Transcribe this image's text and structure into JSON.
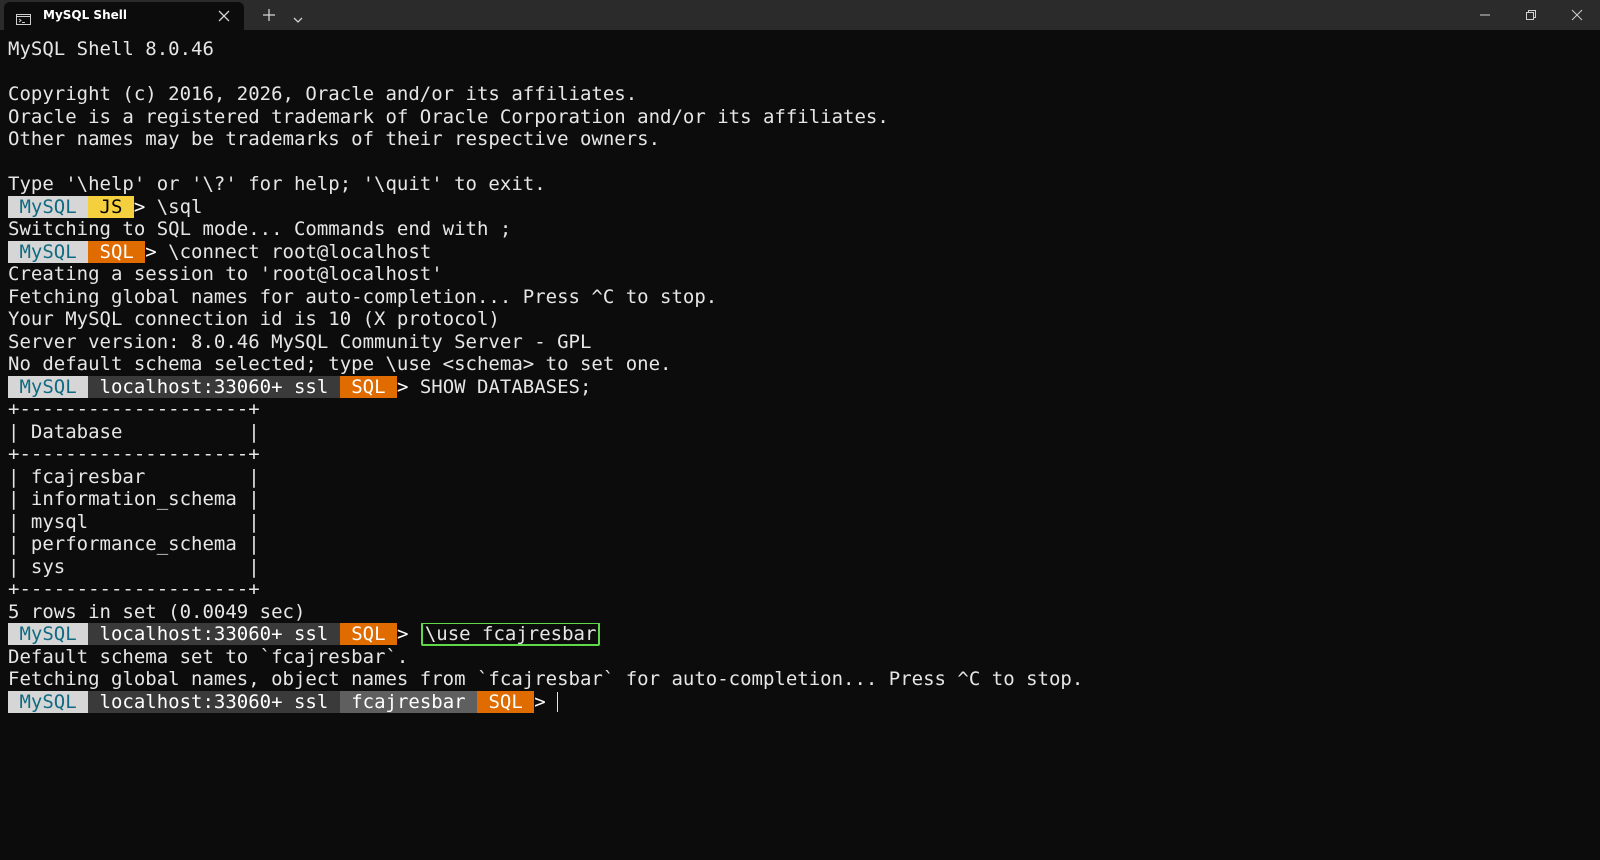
{
  "window": {
    "tab_title": "MySQL Shell",
    "tab_icon": "terminal-icon"
  },
  "terminal": {
    "banner": "MySQL Shell 8.0.46",
    "copyright_1": "Copyright (c) 2016, 2026, Oracle and/or its affiliates.",
    "copyright_2": "Oracle is a registered trademark of Oracle Corporation and/or its affiliates.",
    "copyright_3": "Other names may be trademarks of their respective owners.",
    "help_hint": "Type '\\help' or '\\?' for help; '\\quit' to exit.",
    "prompt_1": {
      "mysql": " MySQL ",
      "mode": " JS ",
      "arrow": "> ",
      "command": "\\sql"
    },
    "out_switch": "Switching to SQL mode... Commands end with ;",
    "prompt_2": {
      "mysql": " MySQL ",
      "mode": " SQL ",
      "arrow": "> ",
      "command": "\\connect root@localhost"
    },
    "out_session": "Creating a session to 'root@localhost'",
    "out_fetch_1": "Fetching global names for auto-completion... Press ^C to stop.",
    "out_conn_id": "Your MySQL connection id is 10 (X protocol)",
    "out_server": "Server version: 8.0.46 MySQL Community Server - GPL",
    "out_no_schema": "No default schema selected; type \\use <schema> to set one.",
    "prompt_3": {
      "mysql": " MySQL ",
      "host": " localhost:33060+ ssl ",
      "mode": " SQL ",
      "arrow": "> ",
      "command": "SHOW DATABASES;"
    },
    "table": {
      "border": "+--------------------+",
      "header": "| Database           |",
      "rows": [
        "| fcajresbar         |",
        "| information_schema |",
        "| mysql              |",
        "| performance_schema |",
        "| sys                |"
      ]
    },
    "out_rows": "5 rows in set (0.0049 sec)",
    "prompt_4": {
      "mysql": " MySQL ",
      "host": " localhost:33060+ ssl ",
      "mode": " SQL ",
      "arrow": "> ",
      "command": "\\use fcajresbar"
    },
    "out_default_schema": "Default schema set to `fcajresbar`.",
    "out_fetch_2": "Fetching global names, object names from `fcajresbar` for auto-completion... Press ^C to stop.",
    "prompt_5": {
      "mysql": " MySQL ",
      "host": " localhost:33060+ ssl ",
      "schema": " fcajresbar ",
      "mode": " SQL ",
      "arrow": "> "
    }
  },
  "colors": {
    "terminal_bg": "#0c0c0c",
    "titlebar_bg": "#2b2b2b",
    "mysql_segment": "#d6d6d6",
    "js_segment": "#f4d03f",
    "sql_segment": "#e06c00",
    "host_segment": "#3a3a3a",
    "schema_segment": "#5f5f5f",
    "highlight_border": "#5fd94a"
  }
}
